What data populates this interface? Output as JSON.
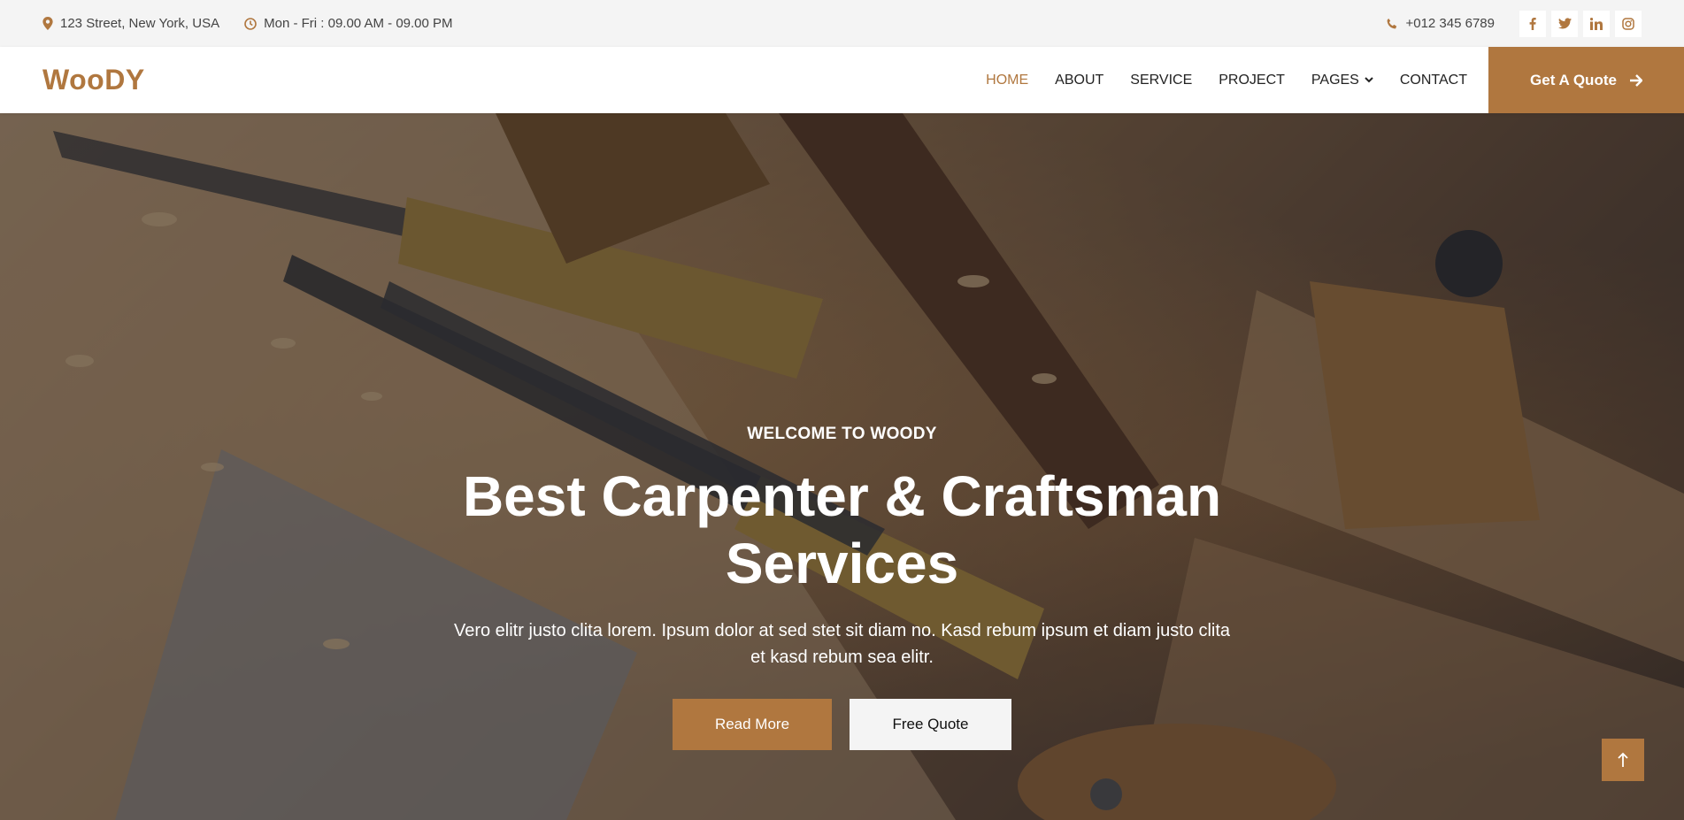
{
  "topbar": {
    "address": "123 Street, New York, USA",
    "hours": "Mon - Fri : 09.00 AM - 09.00 PM",
    "phone": "+012 345 6789",
    "socials": [
      "facebook-icon",
      "twitter-icon",
      "linkedin-icon",
      "instagram-icon"
    ]
  },
  "nav": {
    "brand": "WooDY",
    "items": [
      {
        "label": "HOME",
        "active": true
      },
      {
        "label": "ABOUT"
      },
      {
        "label": "SERVICE"
      },
      {
        "label": "PROJECT"
      },
      {
        "label": "PAGES",
        "dropdown": true
      },
      {
        "label": "CONTACT"
      }
    ],
    "quote_label": "Get A Quote"
  },
  "hero": {
    "kicker": "WELCOME TO WOODY",
    "headline": "Best Carpenter & Craftsman Services",
    "subtext": "Vero elitr justo clita lorem. Ipsum dolor at sed stet sit diam no. Kasd rebum ipsum et diam justo clita et kasd rebum sea elitr.",
    "primary_button": "Read More",
    "secondary_button": "Free Quote"
  },
  "colors": {
    "accent": "#b0773f",
    "topbar_bg": "#f4f4f4"
  }
}
